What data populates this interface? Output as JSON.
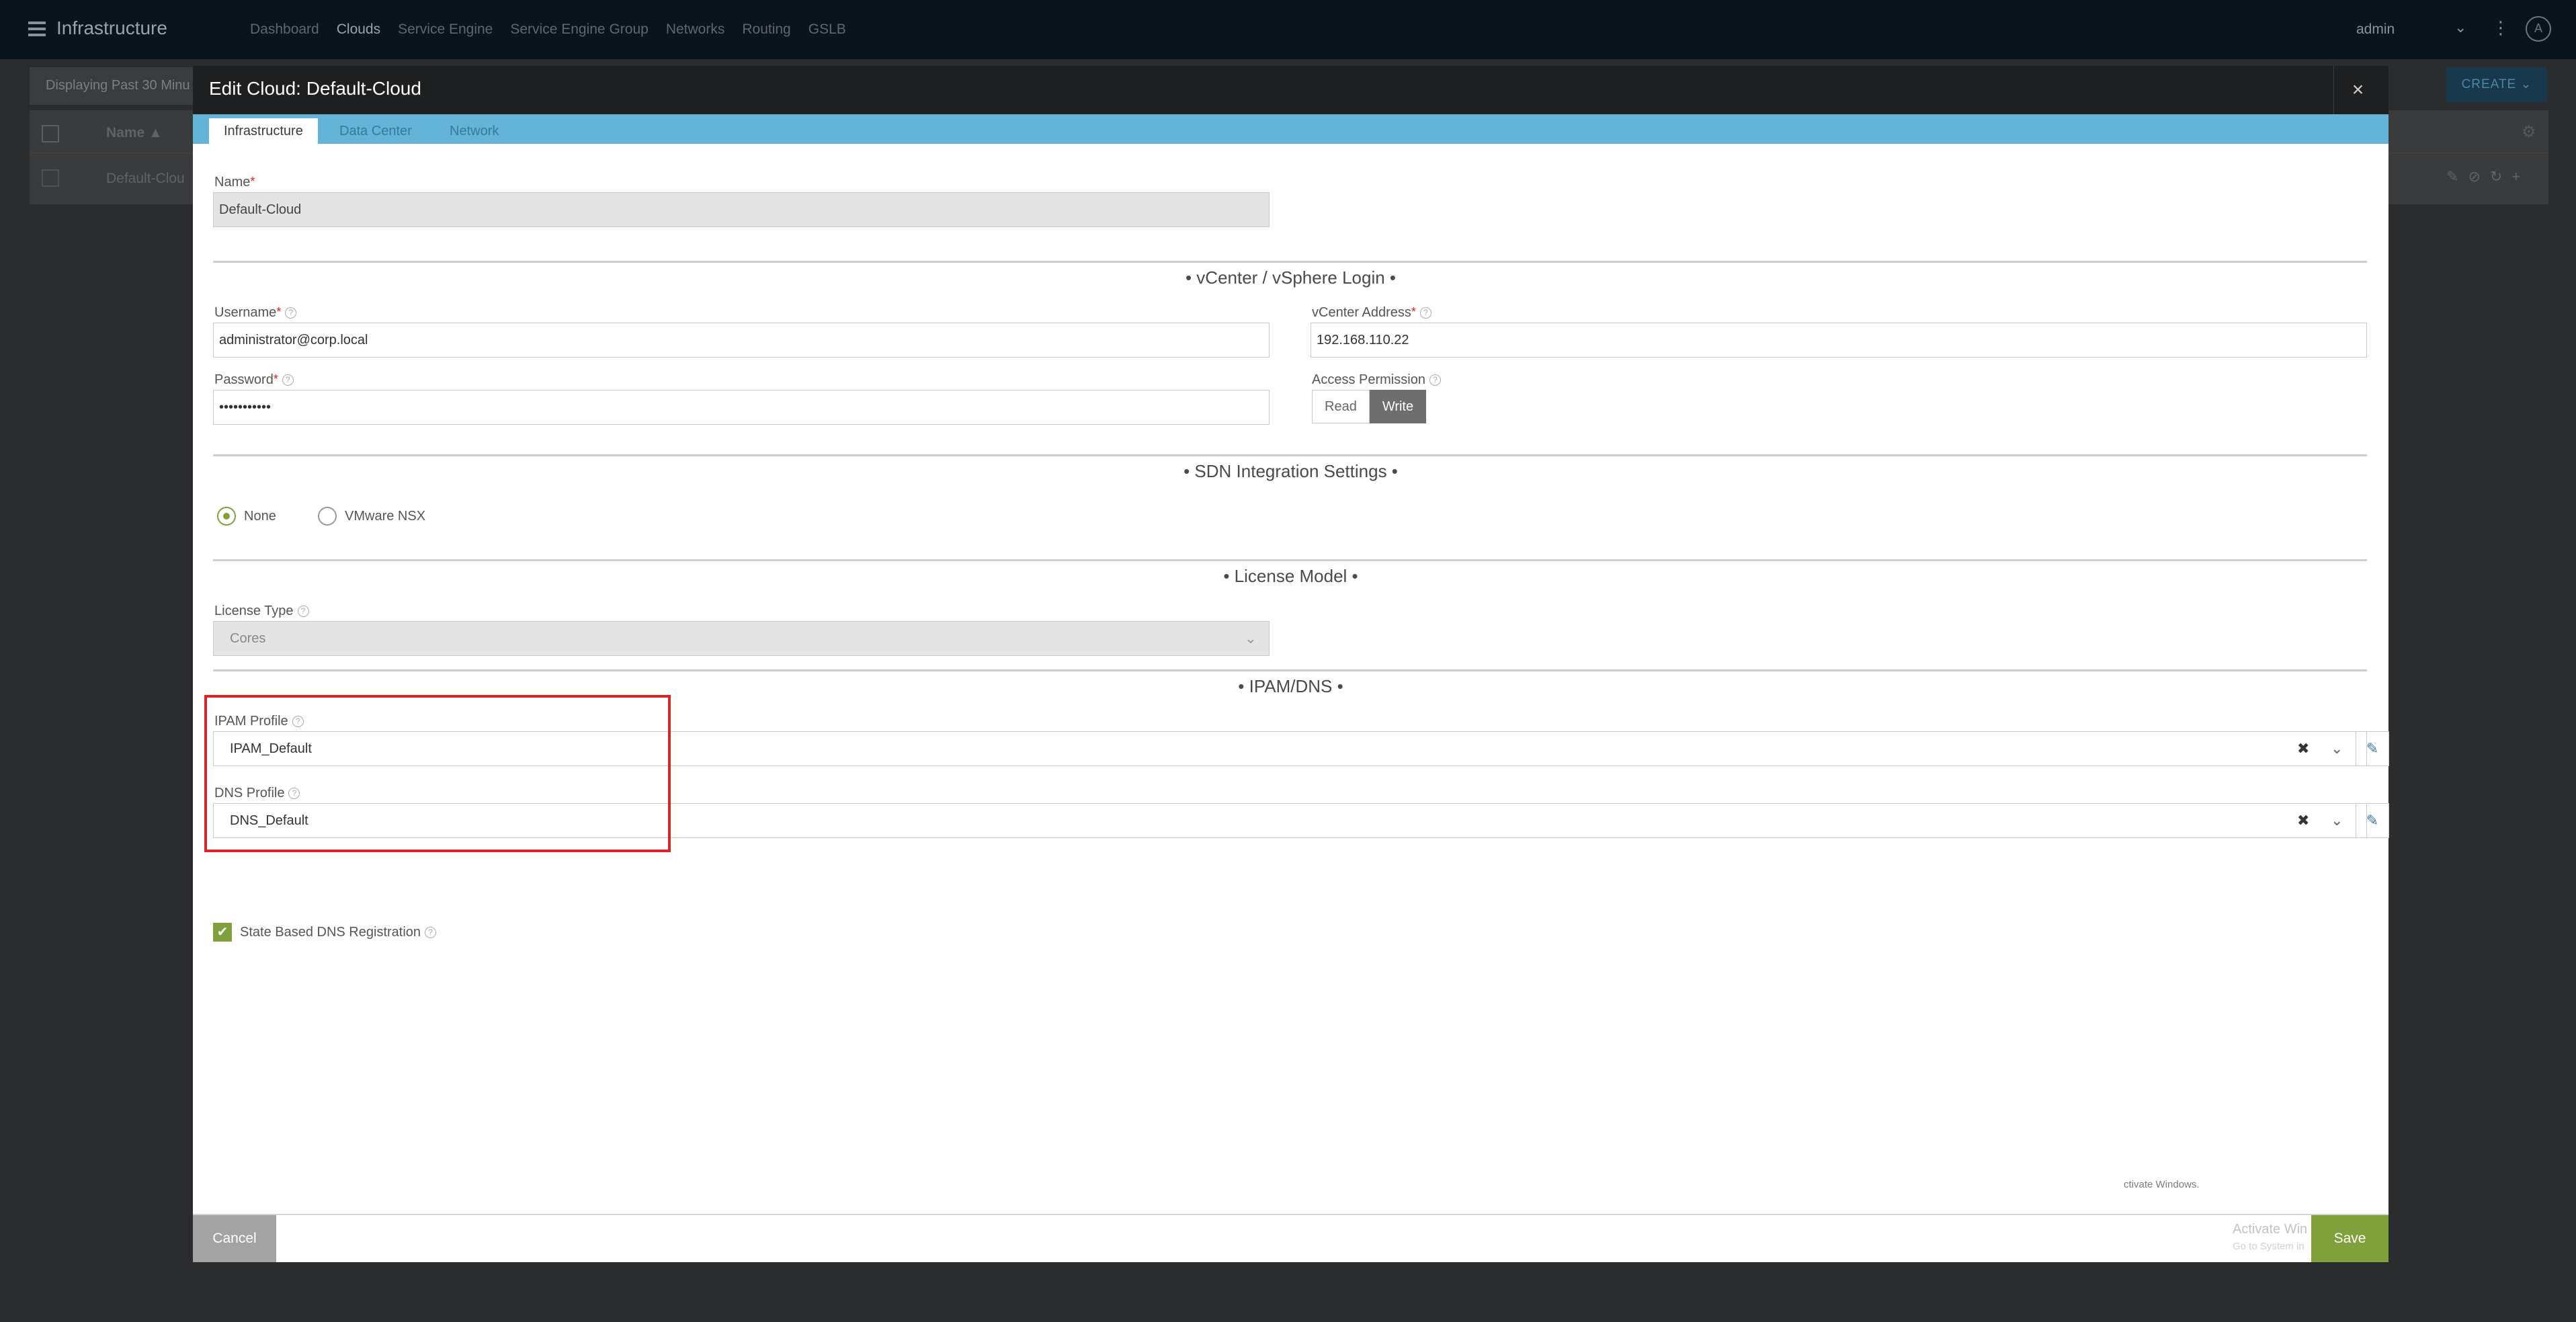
{
  "app": {
    "title": "Infrastructure",
    "nav": [
      "Dashboard",
      "Clouds",
      "Service Engine",
      "Service Engine Group",
      "Networks",
      "Routing",
      "GSLB"
    ],
    "active_nav": "Clouds",
    "user": "admin",
    "create_label": "CREATE",
    "time_filter": "Displaying Past 30 Minu",
    "table_header_name": "Name",
    "table_row_name": "Default-Clou"
  },
  "modal": {
    "title": "Edit Cloud: Default-Cloud",
    "close_glyph": "×",
    "tabs": [
      "Infrastructure",
      "Data Center",
      "Network"
    ],
    "name": {
      "label": "Name",
      "value": "Default-Cloud"
    },
    "vcenter_section": "• vCenter / vSphere Login •",
    "username": {
      "label": "Username",
      "value": "administrator@corp.local"
    },
    "vcenter_address": {
      "label": "vCenter Address",
      "value": "192.168.110.22"
    },
    "password": {
      "label": "Password",
      "value": "•••••••••••"
    },
    "access_permission": {
      "label": "Access Permission",
      "options": [
        "Read",
        "Write"
      ],
      "selected": "Write"
    },
    "sdn_section": "• SDN Integration Settings •",
    "sdn_options": [
      "None",
      "VMware NSX"
    ],
    "sdn_selected": "None",
    "license_section": "• License Model •",
    "license_type": {
      "label": "License Type",
      "value": "Cores"
    },
    "ipam_section": "• IPAM/DNS •",
    "ipam_profile": {
      "label": "IPAM Profile",
      "value": "IPAM_Default"
    },
    "dns_profile": {
      "label": "DNS Profile",
      "value": "DNS_Default"
    },
    "state_dns": {
      "label": "State Based DNS Registration",
      "checked": true
    },
    "cancel_label": "Cancel",
    "save_label": "Save",
    "watermark_title": "Activate Win",
    "watermark_sub": "Go to System in",
    "watermark_tail": "ctivate Windows."
  },
  "colors": {
    "accent_tab": "#63b4d6",
    "save": "#7fa03a",
    "highlight": "#d9242a"
  }
}
